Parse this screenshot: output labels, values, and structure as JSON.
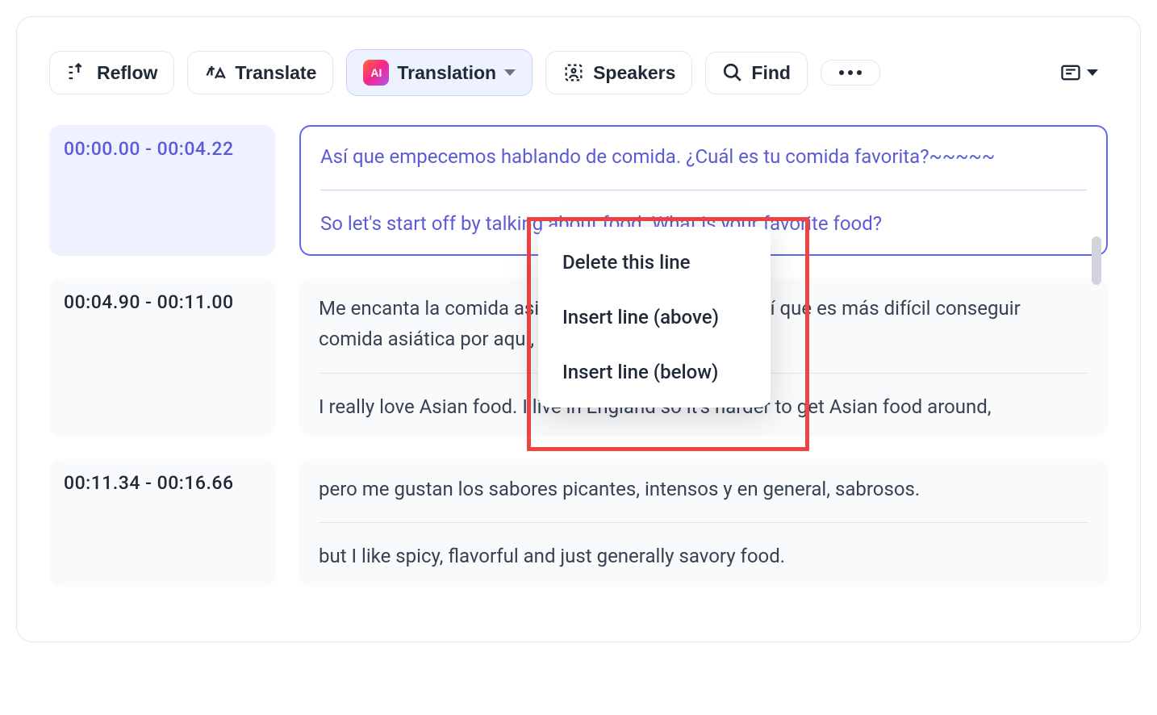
{
  "toolbar": {
    "reflow_label": "Reflow",
    "translate_label": "Translate",
    "translation_label": "Translation",
    "speakers_label": "Speakers",
    "find_label": "Find"
  },
  "context_menu": {
    "delete_line": "Delete this line",
    "insert_above": "Insert line (above)",
    "insert_below": "Insert line (below)"
  },
  "segments": [
    {
      "timestamp": "00:00.00 - 00:04.22",
      "source": "Así que empecemos hablando de comida. ¿Cuál es tu comida favorita?~~~~~",
      "translation": "So let's start off by talking about food. What is your favorite food?",
      "highlighted": true
    },
    {
      "timestamp": "00:04.90  -  00:11.00",
      "source": "Me encanta la comida asiática. Vivo en Inglaterra, así que es más difícil conseguir comida asiática por aquí,",
      "translation": "I really love Asian food. I live in England so it's harder to get Asian food around,",
      "highlighted": false
    },
    {
      "timestamp": "00:11.34  -  00:16.66",
      "source": "pero me gustan los sabores picantes, intensos y en general, sabrosos.",
      "translation": "but I like spicy, flavorful and just generally savory food.",
      "highlighted": false
    }
  ]
}
